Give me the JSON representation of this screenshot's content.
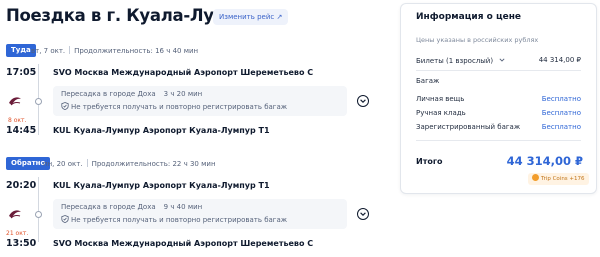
{
  "header": {
    "title": "Поездка в г. Куала-Лумпур",
    "change_trip": "Изменить рейс ↗"
  },
  "legs": [
    {
      "direction": "Туда",
      "date": "вт, 7 окт.",
      "duration": "Продолжительность: 16 ч 40 мин",
      "depart_time": "17:05",
      "depart_airport": "SVO Москва Международный Аэропорт Шереметьево С",
      "arrive_time": "14:45",
      "arrive_date_note": "8 окт.",
      "arrive_airport": "KUL Куала-Лумпур Аэропорт Куала-Лумпур T1",
      "stop_city": "Пересадка в городе Доха",
      "stop_duration": "3 ч 20 мин",
      "baggage_note": "Не требуется получать и повторно регистрировать багаж"
    },
    {
      "direction": "Обратно",
      "date": "пн, 20 окт.",
      "duration": "Продолжительность: 22 ч 30 мин",
      "depart_time": "20:20",
      "depart_airport": "KUL Куала-Лумпур Аэропорт Куала-Лумпур T1",
      "arrive_time": "13:50",
      "arrive_date_note": "21 окт.",
      "arrive_airport": "SVO Москва Международный Аэропорт Шереметьево С",
      "stop_city": "Пересадка в городе Доха",
      "stop_duration": "9 ч 40 мин",
      "baggage_note": "Не требуется получать и повторно регистрировать багаж"
    }
  ],
  "price_info": {
    "title": "Информация о цене",
    "currency_note": "Цены указаны в российских рублях",
    "tickets_label": "Билеты (1 взрослый)",
    "tickets_value": "44 314,00 ₽",
    "baggage_section": "Багаж",
    "baggage_rows": [
      {
        "label": "Личная вещь",
        "value": "Бесплатно"
      },
      {
        "label": "Ручная кладь",
        "value": "Бесплатно"
      },
      {
        "label": "Зарегистрированный багаж",
        "value": "Бесплатно"
      }
    ],
    "total_label": "Итого",
    "total_value": "44 314,00 ₽",
    "trip_coins": "Trip Coins +176"
  },
  "colors": {
    "accent": "#2f66d6",
    "next_day": "#e0532a",
    "coins": "#f29d2b"
  },
  "icons": [
    "airline-logo-icon",
    "shield-check-icon",
    "chevron-down-icon",
    "external-link-icon",
    "coin-icon"
  ]
}
